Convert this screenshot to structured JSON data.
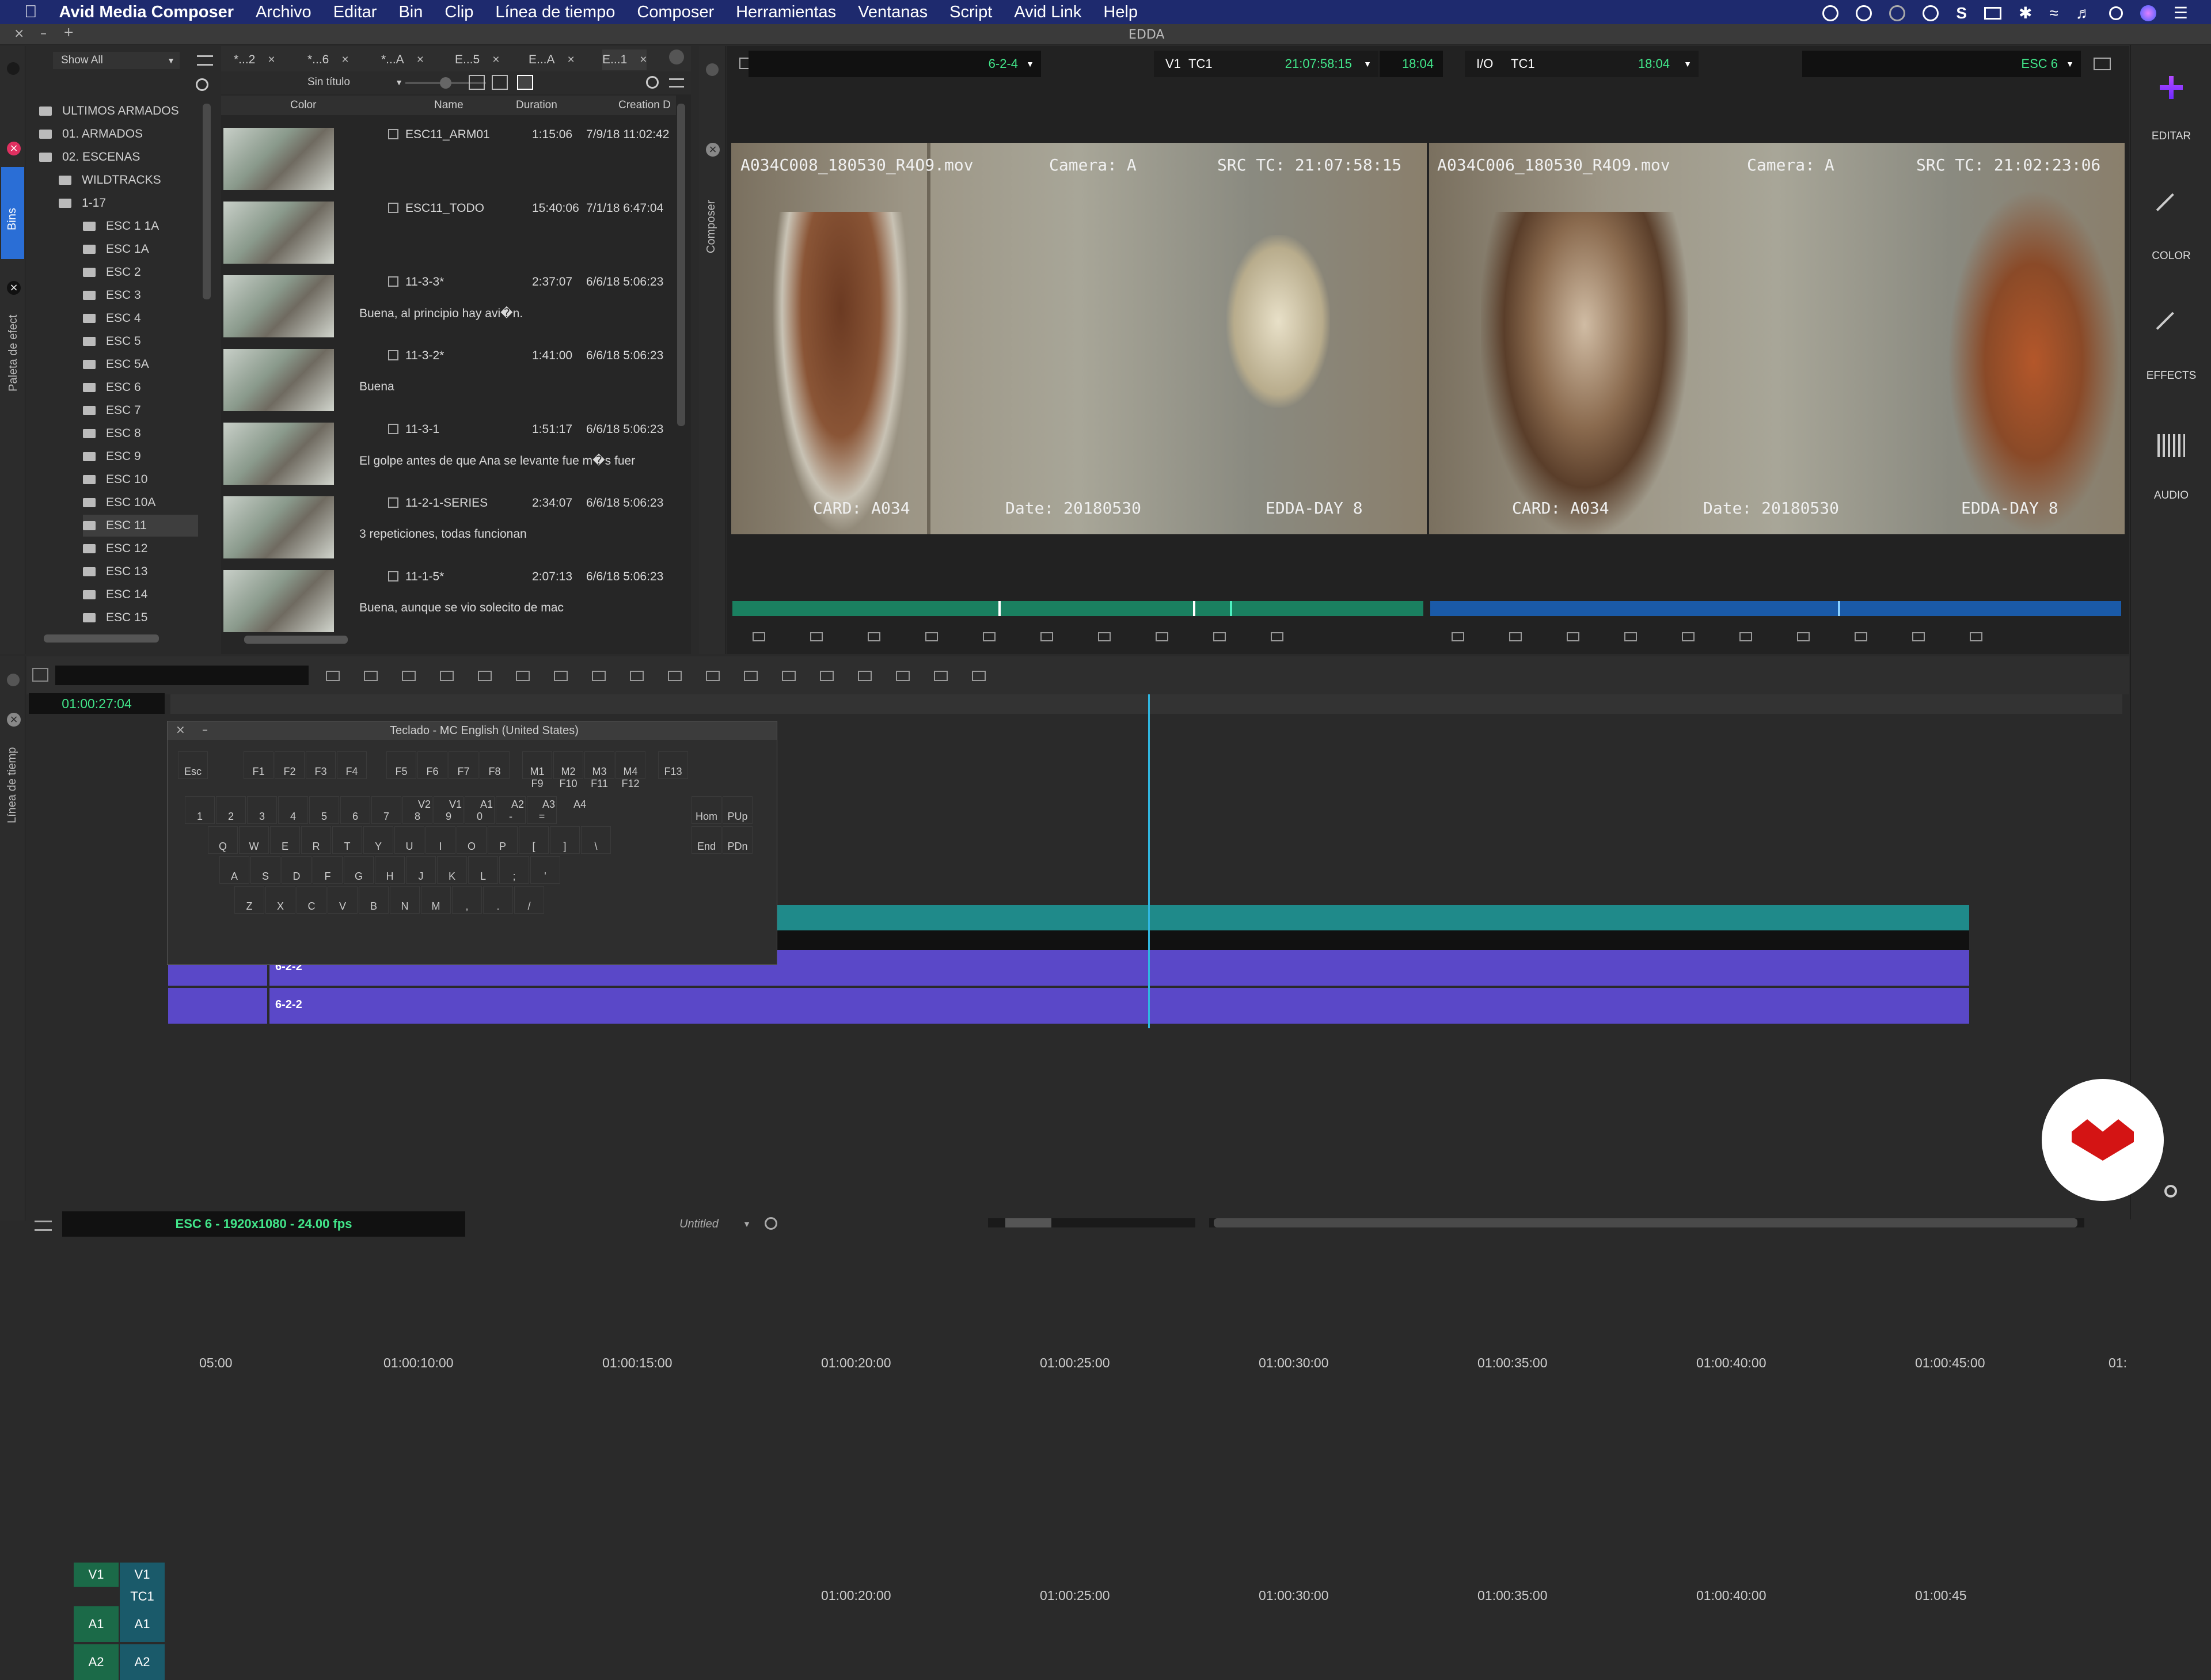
{
  "menubar": {
    "app_name": "Avid Media Composer",
    "items": [
      "Archivo",
      "Editar",
      "Bin",
      "Clip",
      "Línea de tiempo",
      "Composer",
      "Herramientas",
      "Ventanas",
      "Script",
      "Avid Link",
      "Help"
    ]
  },
  "project_title": "EDDA",
  "bins_panel": {
    "tab_label": "Bins",
    "show_all": "Show All",
    "tree": [
      {
        "label": "ULTIMOS ARMADOS",
        "indent": 0
      },
      {
        "label": "01. ARMADOS",
        "indent": 0
      },
      {
        "label": "02. ESCENAS",
        "indent": 0
      },
      {
        "label": "WILDTRACKS",
        "indent": 1
      },
      {
        "label": "1-17",
        "indent": 1
      },
      {
        "label": "ESC 1 1A",
        "indent": 2
      },
      {
        "label": "ESC 1A",
        "indent": 2
      },
      {
        "label": "ESC 2",
        "indent": 2
      },
      {
        "label": "ESC 3",
        "indent": 2
      },
      {
        "label": "ESC 4",
        "indent": 2
      },
      {
        "label": "ESC 5",
        "indent": 2
      },
      {
        "label": "ESC 5A",
        "indent": 2
      },
      {
        "label": "ESC 6",
        "indent": 2
      },
      {
        "label": "ESC 7",
        "indent": 2
      },
      {
        "label": "ESC 8",
        "indent": 2
      },
      {
        "label": "ESC 9",
        "indent": 2
      },
      {
        "label": "ESC 10",
        "indent": 2
      },
      {
        "label": "ESC 10A",
        "indent": 2
      },
      {
        "label": "ESC 11",
        "indent": 2,
        "selected": true
      },
      {
        "label": "ESC 12",
        "indent": 2
      },
      {
        "label": "ESC 13",
        "indent": 2
      },
      {
        "label": "ESC 14",
        "indent": 2
      },
      {
        "label": "ESC 15",
        "indent": 2
      }
    ],
    "effects_tab_label": "Paleta de efect"
  },
  "bin_window": {
    "tabs": [
      "*...2",
      "*...6",
      "*...A",
      "E...5",
      "E...A",
      "E...1"
    ],
    "view_name": "Sin título",
    "columns": {
      "color": "Color",
      "name": "Name",
      "duration": "Duration",
      "creation": "Creation D"
    },
    "rows": [
      {
        "name": "ESC11_ARM01",
        "duration": "1:15:06",
        "date": "7/9/18 11:02:42",
        "comment": ""
      },
      {
        "name": "ESC11_TODO",
        "duration": "15:40:06",
        "date": "7/1/18 6:47:04",
        "comment": ""
      },
      {
        "name": "11-3-3*",
        "duration": "2:37:07",
        "date": "6/6/18 5:06:23",
        "comment": "Buena, al principio hay avi�n."
      },
      {
        "name": "11-3-2*",
        "duration": "1:41:00",
        "date": "6/6/18 5:06:23",
        "comment": "Buena"
      },
      {
        "name": "11-3-1",
        "duration": "1:51:17",
        "date": "6/6/18 5:06:23",
        "comment": "El golpe antes de que Ana se levante fue m�s fuer"
      },
      {
        "name": "11-2-1-SERIES",
        "duration": "2:34:07",
        "date": "6/6/18 5:06:23",
        "comment": "3 repeticiones, todas funcionan"
      },
      {
        "name": "11-1-5*",
        "duration": "2:07:13",
        "date": "6/6/18 5:06:23",
        "comment": "Buena, aunque se vio solecito de mac"
      }
    ]
  },
  "composer": {
    "tab_label": "Composer",
    "source_clip": "6-2-4",
    "track_label": "V1",
    "tc_label": "TC1",
    "source_tc": "21:07:58:15",
    "source_dur": "18:04",
    "io_label": "I/O",
    "io_tc_label": "TC1",
    "io_value": "18:04",
    "record_clip": "ESC 6",
    "left_burnin": {
      "file": "A034C008_180530_R4O9.mov",
      "camera": "Camera: A",
      "src_tc": "SRC TC: 21:07:58:15",
      "card": "CARD: A034",
      "date": "Date: 20180530",
      "day": "EDDA-DAY 8"
    },
    "right_burnin": {
      "file": "A034C006_180530_R4O9.mov",
      "camera": "Camera: A",
      "src_tc": "SRC TC: 21:02:23:06",
      "card": "CARD: A034",
      "date": "Date: 20180530",
      "day": "EDDA-DAY 8"
    },
    "source_position_fraction": 0.72,
    "record_position_fraction": 0.59
  },
  "right_toolbar": {
    "items": [
      {
        "label": "EDITAR",
        "icon": "edit-icon"
      },
      {
        "label": "COLOR",
        "icon": "color-brush-icon"
      },
      {
        "label": "EFFECTS",
        "icon": "effects-wand-icon"
      },
      {
        "label": "AUDIO",
        "icon": "audio-waveform-icon"
      }
    ]
  },
  "timeline": {
    "tab_label": "Línea de tiemp",
    "current_tc": "01:00:27:04",
    "ruler_ticks": [
      "05:00",
      "01:00:10:00",
      "01:00:15:00",
      "01:00:20:00",
      "01:00:25:00",
      "01:00:30:00",
      "01:00:35:00",
      "01:00:40:00",
      "01:00:45:00",
      "01:"
    ],
    "tc_track_ticks": [
      "01:00:20:00",
      "01:00:25:00",
      "01:00:30:00",
      "01:00:35:00",
      "01:00:40:00",
      "01:00:45"
    ],
    "tracks": [
      {
        "src": "V1",
        "rec": "V1",
        "type": "video"
      },
      {
        "src": "",
        "rec": "TC1",
        "type": "tc"
      },
      {
        "src": "A1",
        "rec": "A1",
        "type": "audio",
        "clip": "6-2-2"
      },
      {
        "src": "A2",
        "rec": "A2",
        "type": "audio",
        "clip": "6-2-2"
      }
    ],
    "sequence_info": "ESC 6 - 1920x1080 - 24.00 fps",
    "bottom_menu": "Untitled"
  },
  "keyboard": {
    "title": "Teclado - MC English (United States)",
    "fkeys": [
      "Esc",
      "F1",
      "F2",
      "F3",
      "F4",
      "F5",
      "F6",
      "F7",
      "F8",
      "M1 F9",
      "M2 F10",
      "M3 F11",
      "M4 F12",
      "F13"
    ],
    "num_row": [
      "1",
      "2",
      "3",
      "4",
      "5",
      "6",
      "7",
      "8",
      "9",
      "0",
      "-",
      "="
    ],
    "num_row_labels": [
      "V2",
      "V1",
      "A1",
      "A2",
      "A3",
      "A4"
    ],
    "top_row": [
      "Q",
      "W",
      "E",
      "R",
      "T",
      "Y",
      "U",
      "I",
      "O",
      "P",
      "[",
      "]",
      "\\"
    ],
    "mid_row": [
      "A",
      "S",
      "D",
      "F",
      "G",
      "H",
      "J",
      "K",
      "L",
      ";",
      "'"
    ],
    "bot_row": [
      "Z",
      "X",
      "C",
      "V",
      "B",
      "N",
      "M",
      ",",
      ".",
      "/"
    ],
    "nav_keys": [
      "Hom",
      "PUp",
      "End",
      "PDn"
    ]
  },
  "colors": {
    "menubar": "#1e2a6e",
    "video_track": "#1f8a8a",
    "audio_track": "#5a48c8",
    "tc_green": "#42e68a",
    "playhead": "#2fb6e0"
  }
}
